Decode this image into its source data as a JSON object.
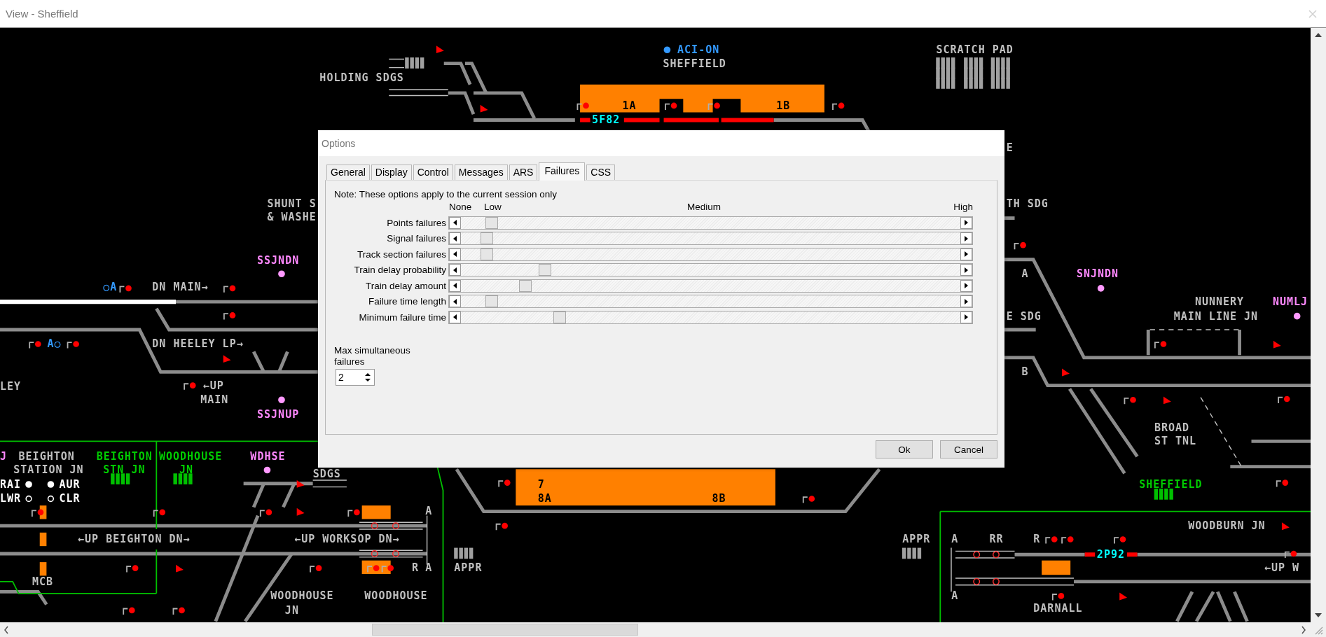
{
  "window": {
    "title": "View - Sheffield"
  },
  "diagram": {
    "labels": [
      {
        "text": "ACI-ON",
        "color": "#3399ff"
      },
      {
        "text": "SHEFFIELD",
        "color": "#c0c0c0"
      },
      {
        "text": "SCRATCH PAD",
        "color": "#c0c0c0"
      },
      {
        "text": "HOLDING SDGS",
        "color": "#c0c0c0"
      },
      {
        "text": "1A",
        "color": "#000000"
      },
      {
        "text": "1B",
        "color": "#000000"
      },
      {
        "text": "5F82",
        "color": "#00ffff"
      },
      {
        "text": "SHUNT S",
        "color": "#c0c0c0"
      },
      {
        "text": "& WASHE",
        "color": "#c0c0c0"
      },
      {
        "text": "SSJNDN",
        "color": "#ff88ff"
      },
      {
        "text": "○A",
        "color": "#3399ff"
      },
      {
        "text": "DN MAIN→",
        "color": "#c0c0c0"
      },
      {
        "text": "A○",
        "color": "#3399ff"
      },
      {
        "text": "DN HEELEY LP→",
        "color": "#c0c0c0"
      },
      {
        "text": "LEY",
        "color": "#c0c0c0"
      },
      {
        "text": "←UP",
        "color": "#c0c0c0"
      },
      {
        "text": "MAIN",
        "color": "#c0c0c0"
      },
      {
        "text": "SSJNUP",
        "color": "#ff88ff"
      },
      {
        "text": "E",
        "color": "#c0c0c0"
      },
      {
        "text": "TH SDG",
        "color": "#c0c0c0"
      },
      {
        "text": "A",
        "color": "#c0c0c0"
      },
      {
        "text": "SNJNDN",
        "color": "#ff88ff"
      },
      {
        "text": "E SDG",
        "color": "#c0c0c0"
      },
      {
        "text": "NUNNERY",
        "color": "#c0c0c0"
      },
      {
        "text": "MAIN LINE JN",
        "color": "#c0c0c0"
      },
      {
        "text": "NUMLJ",
        "color": "#ff88ff"
      },
      {
        "text": "B",
        "color": "#c0c0c0"
      },
      {
        "text": "BROAD",
        "color": "#c0c0c0"
      },
      {
        "text": "ST TNL",
        "color": "#c0c0c0"
      },
      {
        "text": "SHEFFIELD",
        "color": "#00cc00"
      },
      {
        "text": "WOODBURN JN",
        "color": "#c0c0c0"
      },
      {
        "text": "APPR",
        "color": "#c0c0c0"
      },
      {
        "text": "A",
        "color": "#c0c0c0"
      },
      {
        "text": "RR",
        "color": "#c0c0c0"
      },
      {
        "text": "R",
        "color": "#c0c0c0"
      },
      {
        "text": "2P92",
        "color": "#00ffff"
      },
      {
        "text": "←UP W",
        "color": "#c0c0c0"
      },
      {
        "text": "A",
        "color": "#c0c0c0"
      },
      {
        "text": "DARNALL",
        "color": "#c0c0c0"
      },
      {
        "text": "J",
        "color": "#ff88ff"
      },
      {
        "text": "BEIGHTON",
        "color": "#c0c0c0"
      },
      {
        "text": "STATION JN",
        "color": "#c0c0c0"
      },
      {
        "text": "RAI",
        "color": "#ffffff"
      },
      {
        "text": "AUR",
        "color": "#ffffff"
      },
      {
        "text": "LWR",
        "color": "#ffffff"
      },
      {
        "text": "CLR",
        "color": "#ffffff"
      },
      {
        "text": "BEIGHTON",
        "color": "#00cc00"
      },
      {
        "text": "STN JN",
        "color": "#00cc00"
      },
      {
        "text": "WOODHOUSE",
        "color": "#00cc00"
      },
      {
        "text": "JN",
        "color": "#00cc00"
      },
      {
        "text": "WDHSE",
        "color": "#ff88ff"
      },
      {
        "text": "SDGS",
        "color": "#c0c0c0"
      },
      {
        "text": "A",
        "color": "#c0c0c0"
      },
      {
        "text": "←UP BEIGHTON DN→",
        "color": "#c0c0c0"
      },
      {
        "text": "←UP WORKSOP DN→",
        "color": "#c0c0c0"
      },
      {
        "text": "R",
        "color": "#c0c0c0"
      },
      {
        "text": "A",
        "color": "#c0c0c0"
      },
      {
        "text": "MCB",
        "color": "#c0c0c0"
      },
      {
        "text": "WOODHOUSE",
        "color": "#c0c0c0"
      },
      {
        "text": "JN",
        "color": "#c0c0c0"
      },
      {
        "text": "WOODHOUSE",
        "color": "#c0c0c0"
      },
      {
        "text": "APPR",
        "color": "#c0c0c0"
      },
      {
        "text": "7",
        "color": "#000000"
      },
      {
        "text": "8A",
        "color": "#000000"
      },
      {
        "text": "8B",
        "color": "#000000"
      }
    ]
  },
  "dialog": {
    "title": "Options",
    "tabs": [
      {
        "label": "General",
        "selected": false
      },
      {
        "label": "Display",
        "selected": false
      },
      {
        "label": "Control",
        "selected": false
      },
      {
        "label": "Messages",
        "selected": false
      },
      {
        "label": "ARS",
        "selected": false
      },
      {
        "label": "Failures",
        "selected": true
      },
      {
        "label": "CSS",
        "selected": false
      }
    ],
    "note": "Note: These options apply to the current session only",
    "scale": [
      "None",
      "Low",
      "Medium",
      "High"
    ],
    "sliders": [
      {
        "label": "Points failures",
        "level": 0.05
      },
      {
        "label": "Signal failures",
        "level": 0.04
      },
      {
        "label": "Track section failures",
        "level": 0.04
      },
      {
        "label": "Train delay probability",
        "level": 0.16
      },
      {
        "label": "Train delay amount",
        "level": 0.12
      },
      {
        "label": "Failure time length",
        "level": 0.05
      },
      {
        "label": "Minimum failure time",
        "level": 0.19
      }
    ],
    "max_failures": {
      "label": "Max simultaneous failures",
      "value": "2"
    },
    "buttons": [
      "Ok",
      "Cancel"
    ]
  }
}
